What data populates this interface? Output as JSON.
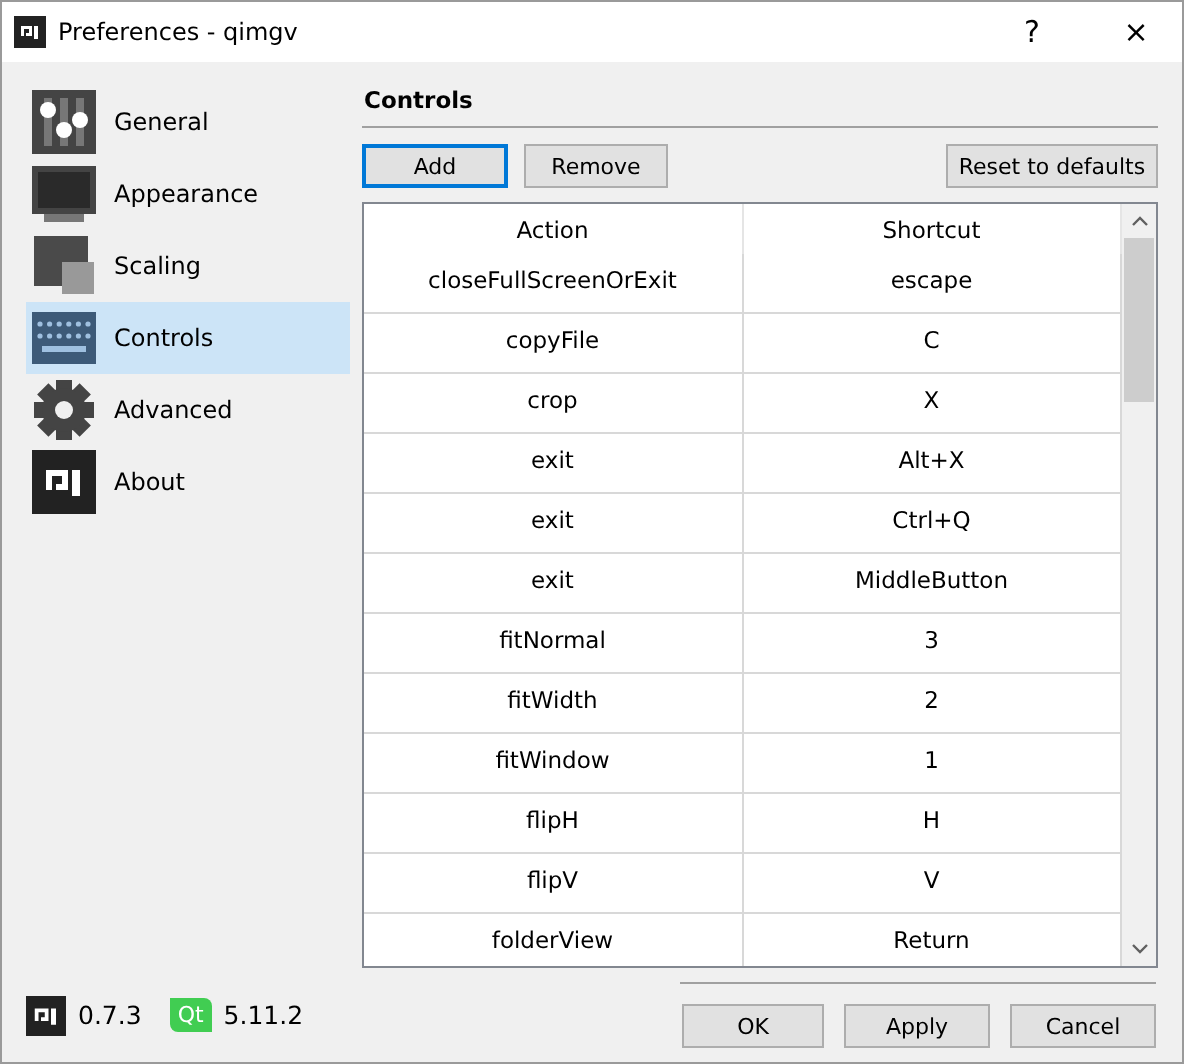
{
  "window": {
    "title": "Preferences - qimgv",
    "help": "?",
    "close": "×"
  },
  "sidebar": {
    "items": [
      {
        "label": "General",
        "selected": false
      },
      {
        "label": "Appearance",
        "selected": false
      },
      {
        "label": "Scaling",
        "selected": false
      },
      {
        "label": "Controls",
        "selected": true
      },
      {
        "label": "Advanced",
        "selected": false
      },
      {
        "label": "About",
        "selected": false
      }
    ]
  },
  "section_title": "Controls",
  "buttons": {
    "add": "Add",
    "remove": "Remove",
    "reset": "Reset to defaults"
  },
  "table": {
    "columns": [
      "Action",
      "Shortcut"
    ],
    "rows": [
      {
        "action": "closeFullScreenOrExit",
        "shortcut": "escape"
      },
      {
        "action": "copyFile",
        "shortcut": "C"
      },
      {
        "action": "crop",
        "shortcut": "X"
      },
      {
        "action": "exit",
        "shortcut": "Alt+X"
      },
      {
        "action": "exit",
        "shortcut": "Ctrl+Q"
      },
      {
        "action": "exit",
        "shortcut": "MiddleButton"
      },
      {
        "action": "fitNormal",
        "shortcut": "3"
      },
      {
        "action": "fitWidth",
        "shortcut": "2"
      },
      {
        "action": "fitWindow",
        "shortcut": "1"
      },
      {
        "action": "flipH",
        "shortcut": "H"
      },
      {
        "action": "flipV",
        "shortcut": "V"
      },
      {
        "action": "folderView",
        "shortcut": "Return"
      }
    ]
  },
  "footer": {
    "app_version": "0.7.3",
    "qt_logo": "Qt",
    "qt_version": "5.11.2",
    "buttons": [
      "OK",
      "Apply",
      "Cancel"
    ]
  }
}
